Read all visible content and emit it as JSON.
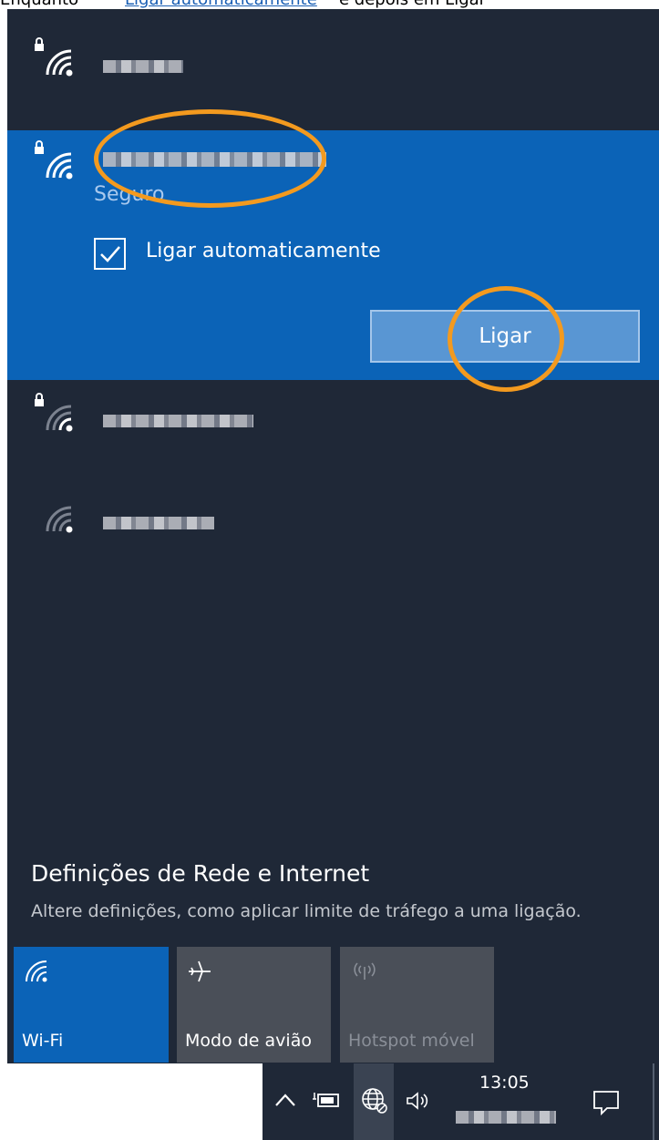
{
  "page_top_text": {
    "before": "Enquanto",
    "link": "Ligar automaticamente",
    "after": "e depois em Ligar"
  },
  "networks": [
    {
      "secured": true,
      "signal": "full",
      "name_blurred": true
    },
    {
      "secured": true,
      "signal": "full",
      "name_blurred": true,
      "selected": true,
      "status": "Seguro"
    },
    {
      "secured": true,
      "signal": "weak",
      "name_blurred": true
    },
    {
      "secured": false,
      "signal": "weak",
      "name_blurred": true
    }
  ],
  "selected_network": {
    "status": "Seguro",
    "auto_connect_label": "Ligar automaticamente",
    "auto_connect_checked": true,
    "connect_button": "Ligar"
  },
  "settings": {
    "title": "Definições de Rede e Internet",
    "description": "Altere definições, como aplicar limite de tráfego a uma ligação."
  },
  "quick_actions": [
    {
      "label": "Wi-Fi",
      "icon": "wifi-icon",
      "active": true
    },
    {
      "label": "Modo de avião",
      "icon": "airplane-icon",
      "active": false
    },
    {
      "label": "Hotspot móvel",
      "icon": "hotspot-icon",
      "active": false,
      "disabled": true
    }
  ],
  "taskbar": {
    "time": "13:05",
    "icons": [
      "chevron-up-icon",
      "battery-icon",
      "network-icon",
      "volume-icon",
      "action-center-icon"
    ]
  },
  "colors": {
    "panel": "#1f2837",
    "selected": "#0b63b7",
    "accent": "#0b63b7",
    "highlight": "#f39a1f",
    "tile_inactive": "#4a4f58"
  }
}
